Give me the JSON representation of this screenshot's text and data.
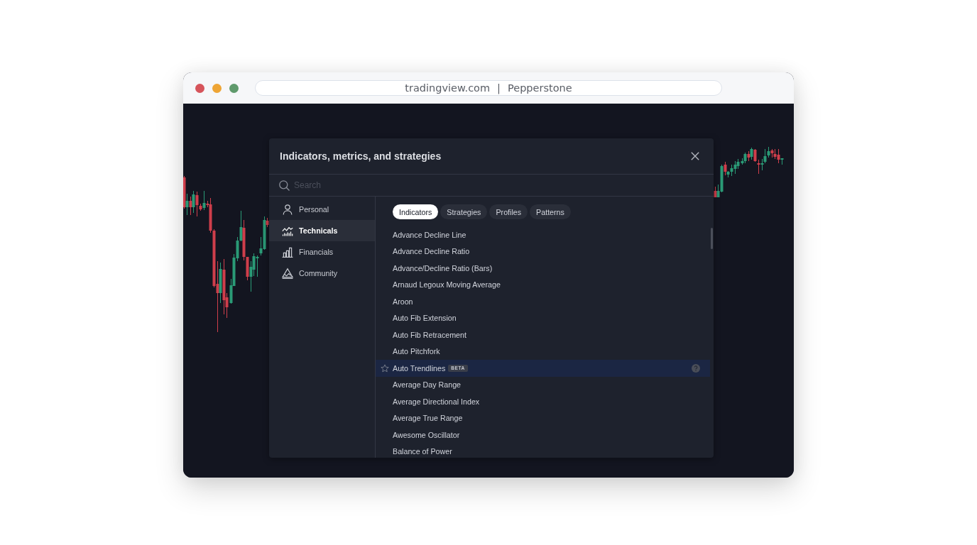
{
  "browser": {
    "address_bar": {
      "domain": "tradingview.com",
      "separator": "|",
      "site": "Pepperstone"
    }
  },
  "dialog": {
    "title": "Indicators, metrics, and strategies",
    "search": {
      "placeholder": "Search"
    },
    "sidebar": {
      "items": [
        {
          "label": "Personal",
          "selected": false
        },
        {
          "label": "Technicals",
          "selected": true
        },
        {
          "label": "Financials",
          "selected": false
        },
        {
          "label": "Community",
          "selected": false
        }
      ]
    },
    "tabs": [
      {
        "label": "Indicators",
        "selected": true
      },
      {
        "label": "Strategies",
        "selected": false
      },
      {
        "label": "Profiles",
        "selected": false
      },
      {
        "label": "Patterns",
        "selected": false
      }
    ],
    "list": {
      "items": [
        {
          "label": "Advance Decline Line",
          "selected": false
        },
        {
          "label": "Advance Decline Ratio",
          "selected": false
        },
        {
          "label": "Advance/Decline Ratio (Bars)",
          "selected": false
        },
        {
          "label": "Arnaud Legoux Moving Average",
          "selected": false
        },
        {
          "label": "Aroon",
          "selected": false
        },
        {
          "label": "Auto Fib Extension",
          "selected": false
        },
        {
          "label": "Auto Fib Retracement",
          "selected": false
        },
        {
          "label": "Auto Pitchfork",
          "selected": false
        },
        {
          "label": "Auto Trendlines",
          "selected": true,
          "badge": "BETA"
        },
        {
          "label": "Average Day Range",
          "selected": false
        },
        {
          "label": "Average Directional Index",
          "selected": false
        },
        {
          "label": "Average True Range",
          "selected": false
        },
        {
          "label": "Awesome Oscillator",
          "selected": false
        },
        {
          "label": "Balance of Power",
          "selected": false
        }
      ]
    }
  }
}
